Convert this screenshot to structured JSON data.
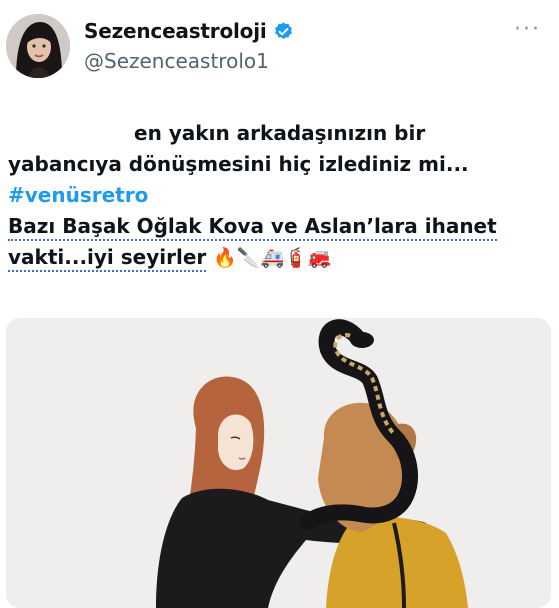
{
  "user": {
    "display_name": "Sezenceastroloji",
    "handle": "@Sezenceastrolo1",
    "verified": true,
    "avatar_icon": "profile-photo"
  },
  "tweet": {
    "line1": "en yakın arkadaşınızın bir",
    "line2": "yabancıya dönüşmesini hiç izlediniz mi...",
    "hashtag": "#venüsretro",
    "line4": "Bazı Başak Oğlak Kova ve Aslan’lara  ihanet",
    "line5": "vakti...iyi seyirler",
    "emojis": "🔥🔪🚑🧯🚒"
  },
  "media": {
    "illustration_icon": "two-women-with-snake-illustration"
  },
  "colors": {
    "hashtag": "#1d9bf0",
    "text": "#0f1419",
    "secondary": "#536471",
    "verified_badge": "#1d9bf0"
  }
}
